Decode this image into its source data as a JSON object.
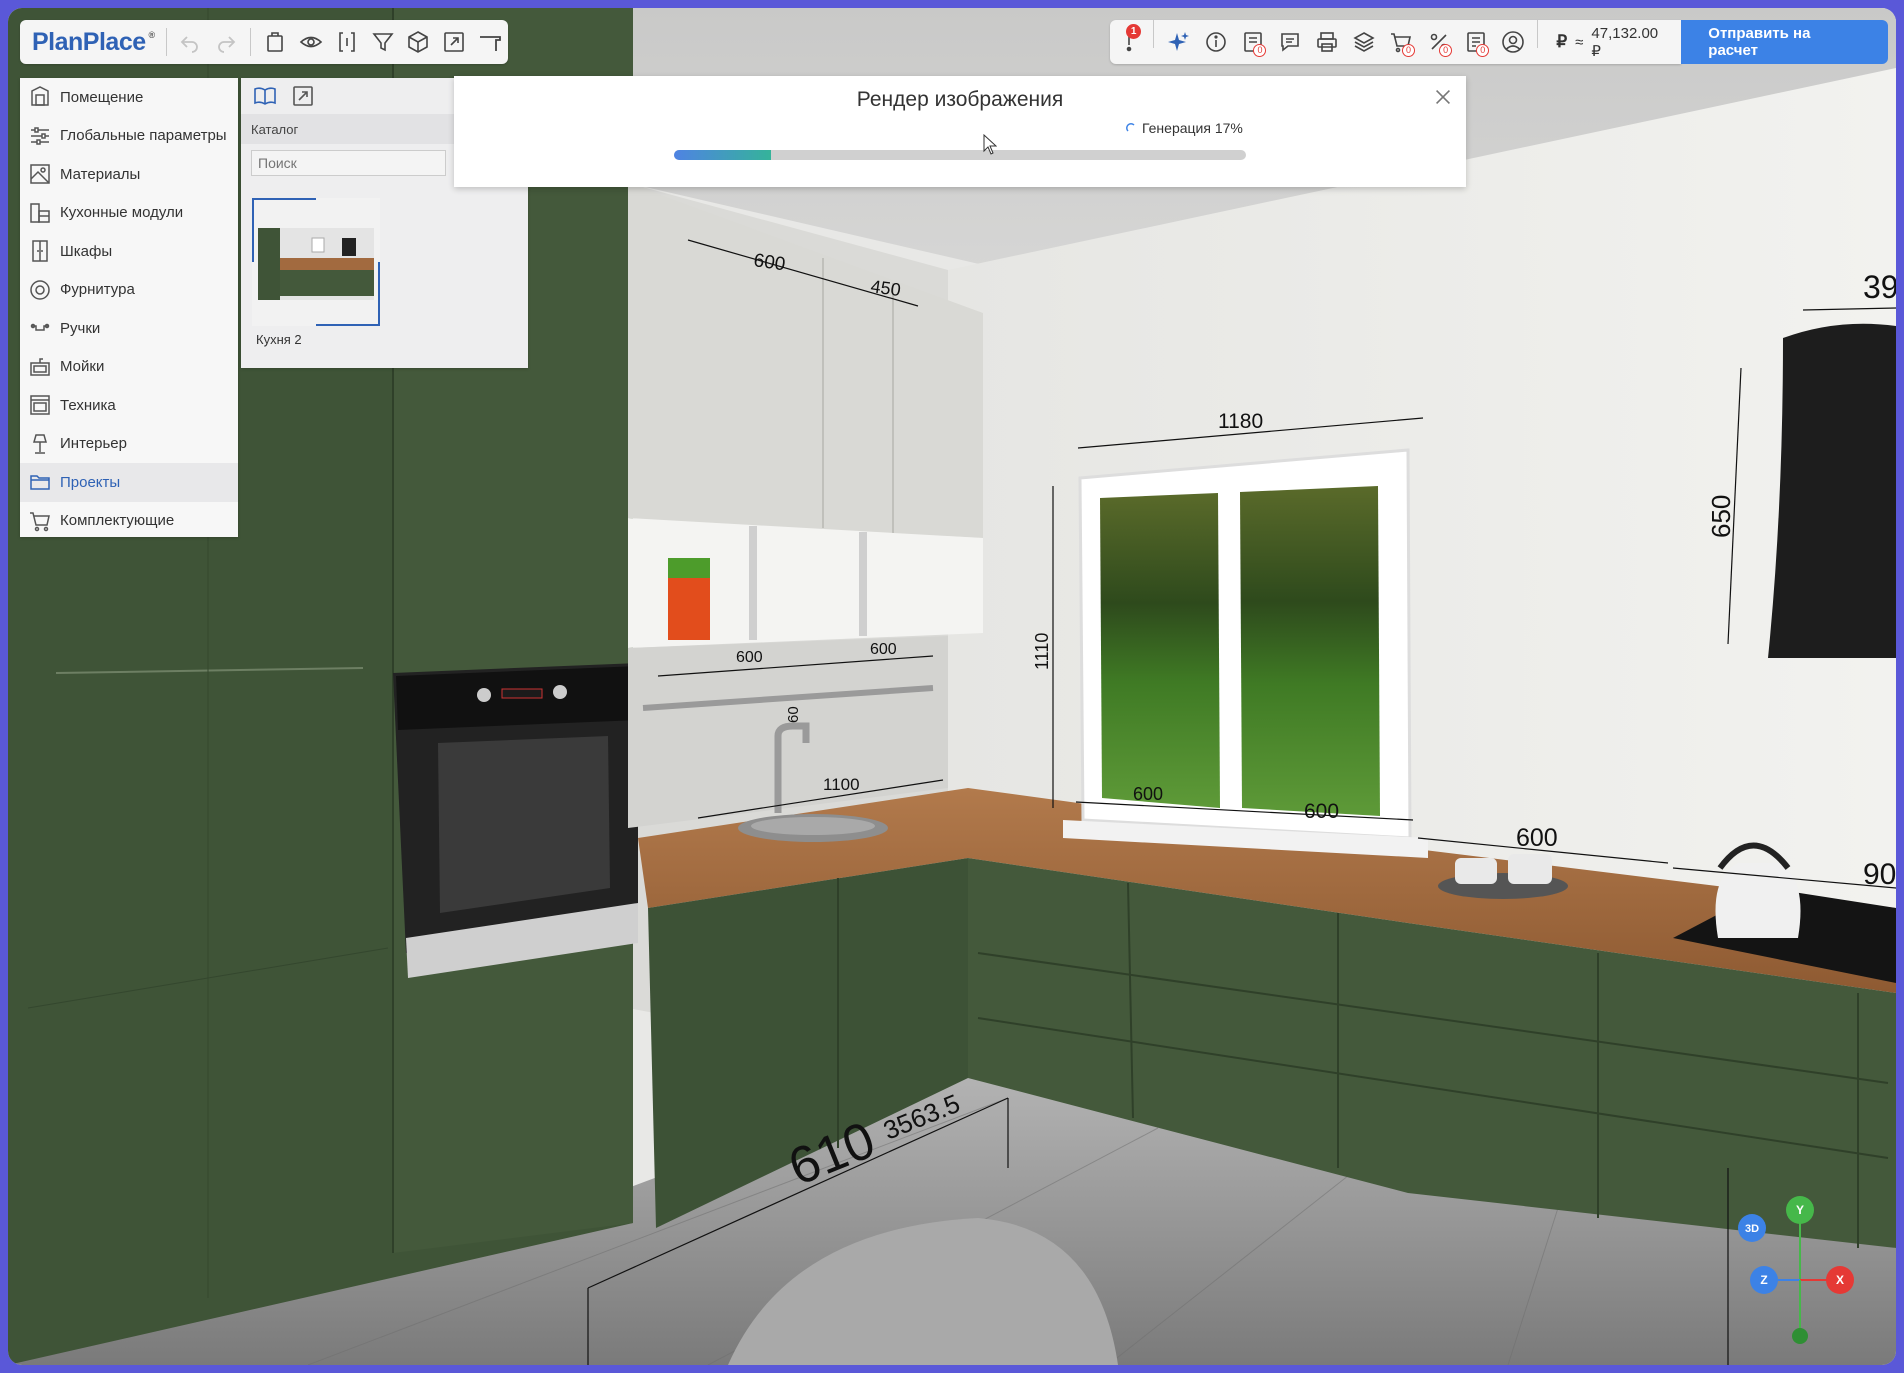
{
  "app": {
    "logo": "PlanPlace",
    "logo_mark": "®"
  },
  "toolbar": {
    "notification_count": "1",
    "badge_zero": "0",
    "currency_symbol": "₽",
    "approx": "≈",
    "price": "47,132.00 ₽",
    "send_label": "Отправить на расчет"
  },
  "sidemenu": {
    "items": [
      {
        "label": "Помещение",
        "icon": "room-icon"
      },
      {
        "label": "Глобальные параметры",
        "icon": "sliders-icon"
      },
      {
        "label": "Материалы",
        "icon": "materials-icon"
      },
      {
        "label": "Кухонные модули",
        "icon": "kitchen-modules-icon"
      },
      {
        "label": "Шкафы",
        "icon": "wardrobe-icon"
      },
      {
        "label": "Фурнитура",
        "icon": "fittings-icon"
      },
      {
        "label": "Ручки",
        "icon": "handle-icon"
      },
      {
        "label": "Мойки",
        "icon": "sink-icon"
      },
      {
        "label": "Техника",
        "icon": "appliance-icon"
      },
      {
        "label": "Интерьер",
        "icon": "interior-icon"
      },
      {
        "label": "Проекты",
        "icon": "folder-icon"
      },
      {
        "label": "Комплектующие",
        "icon": "cart-icon"
      }
    ],
    "active_index": 10
  },
  "catalog": {
    "label": "Каталог",
    "search_placeholder": "Поиск",
    "items": [
      {
        "name": "Кухня 2"
      }
    ]
  },
  "modal": {
    "title": "Рендер изображения",
    "status": "Генерация 17%",
    "progress": 0.17
  },
  "scene": {
    "dimensions": {
      "upper_600": "600",
      "upper_450": "450",
      "window_width": "1180",
      "window_height": "1110",
      "hood_height": "650",
      "hood_width_partial": "39",
      "shelf_600": "600",
      "shelf_600b": "600",
      "rail_60": "60",
      "counter_1100": "1100",
      "win_600a": "600",
      "win_600b": "600",
      "counter_600": "600",
      "counter_90": "90",
      "floor_610": "610",
      "floor_3563": "3563.5"
    },
    "colors": {
      "cabinet_green": "#3f5437",
      "wall": "#ececea",
      "countertop": "#a26a3f",
      "floor": "#8f8f8f"
    }
  },
  "gizmo": {
    "view_label": "3D",
    "y": "Y",
    "z": "Z",
    "x": "X"
  }
}
